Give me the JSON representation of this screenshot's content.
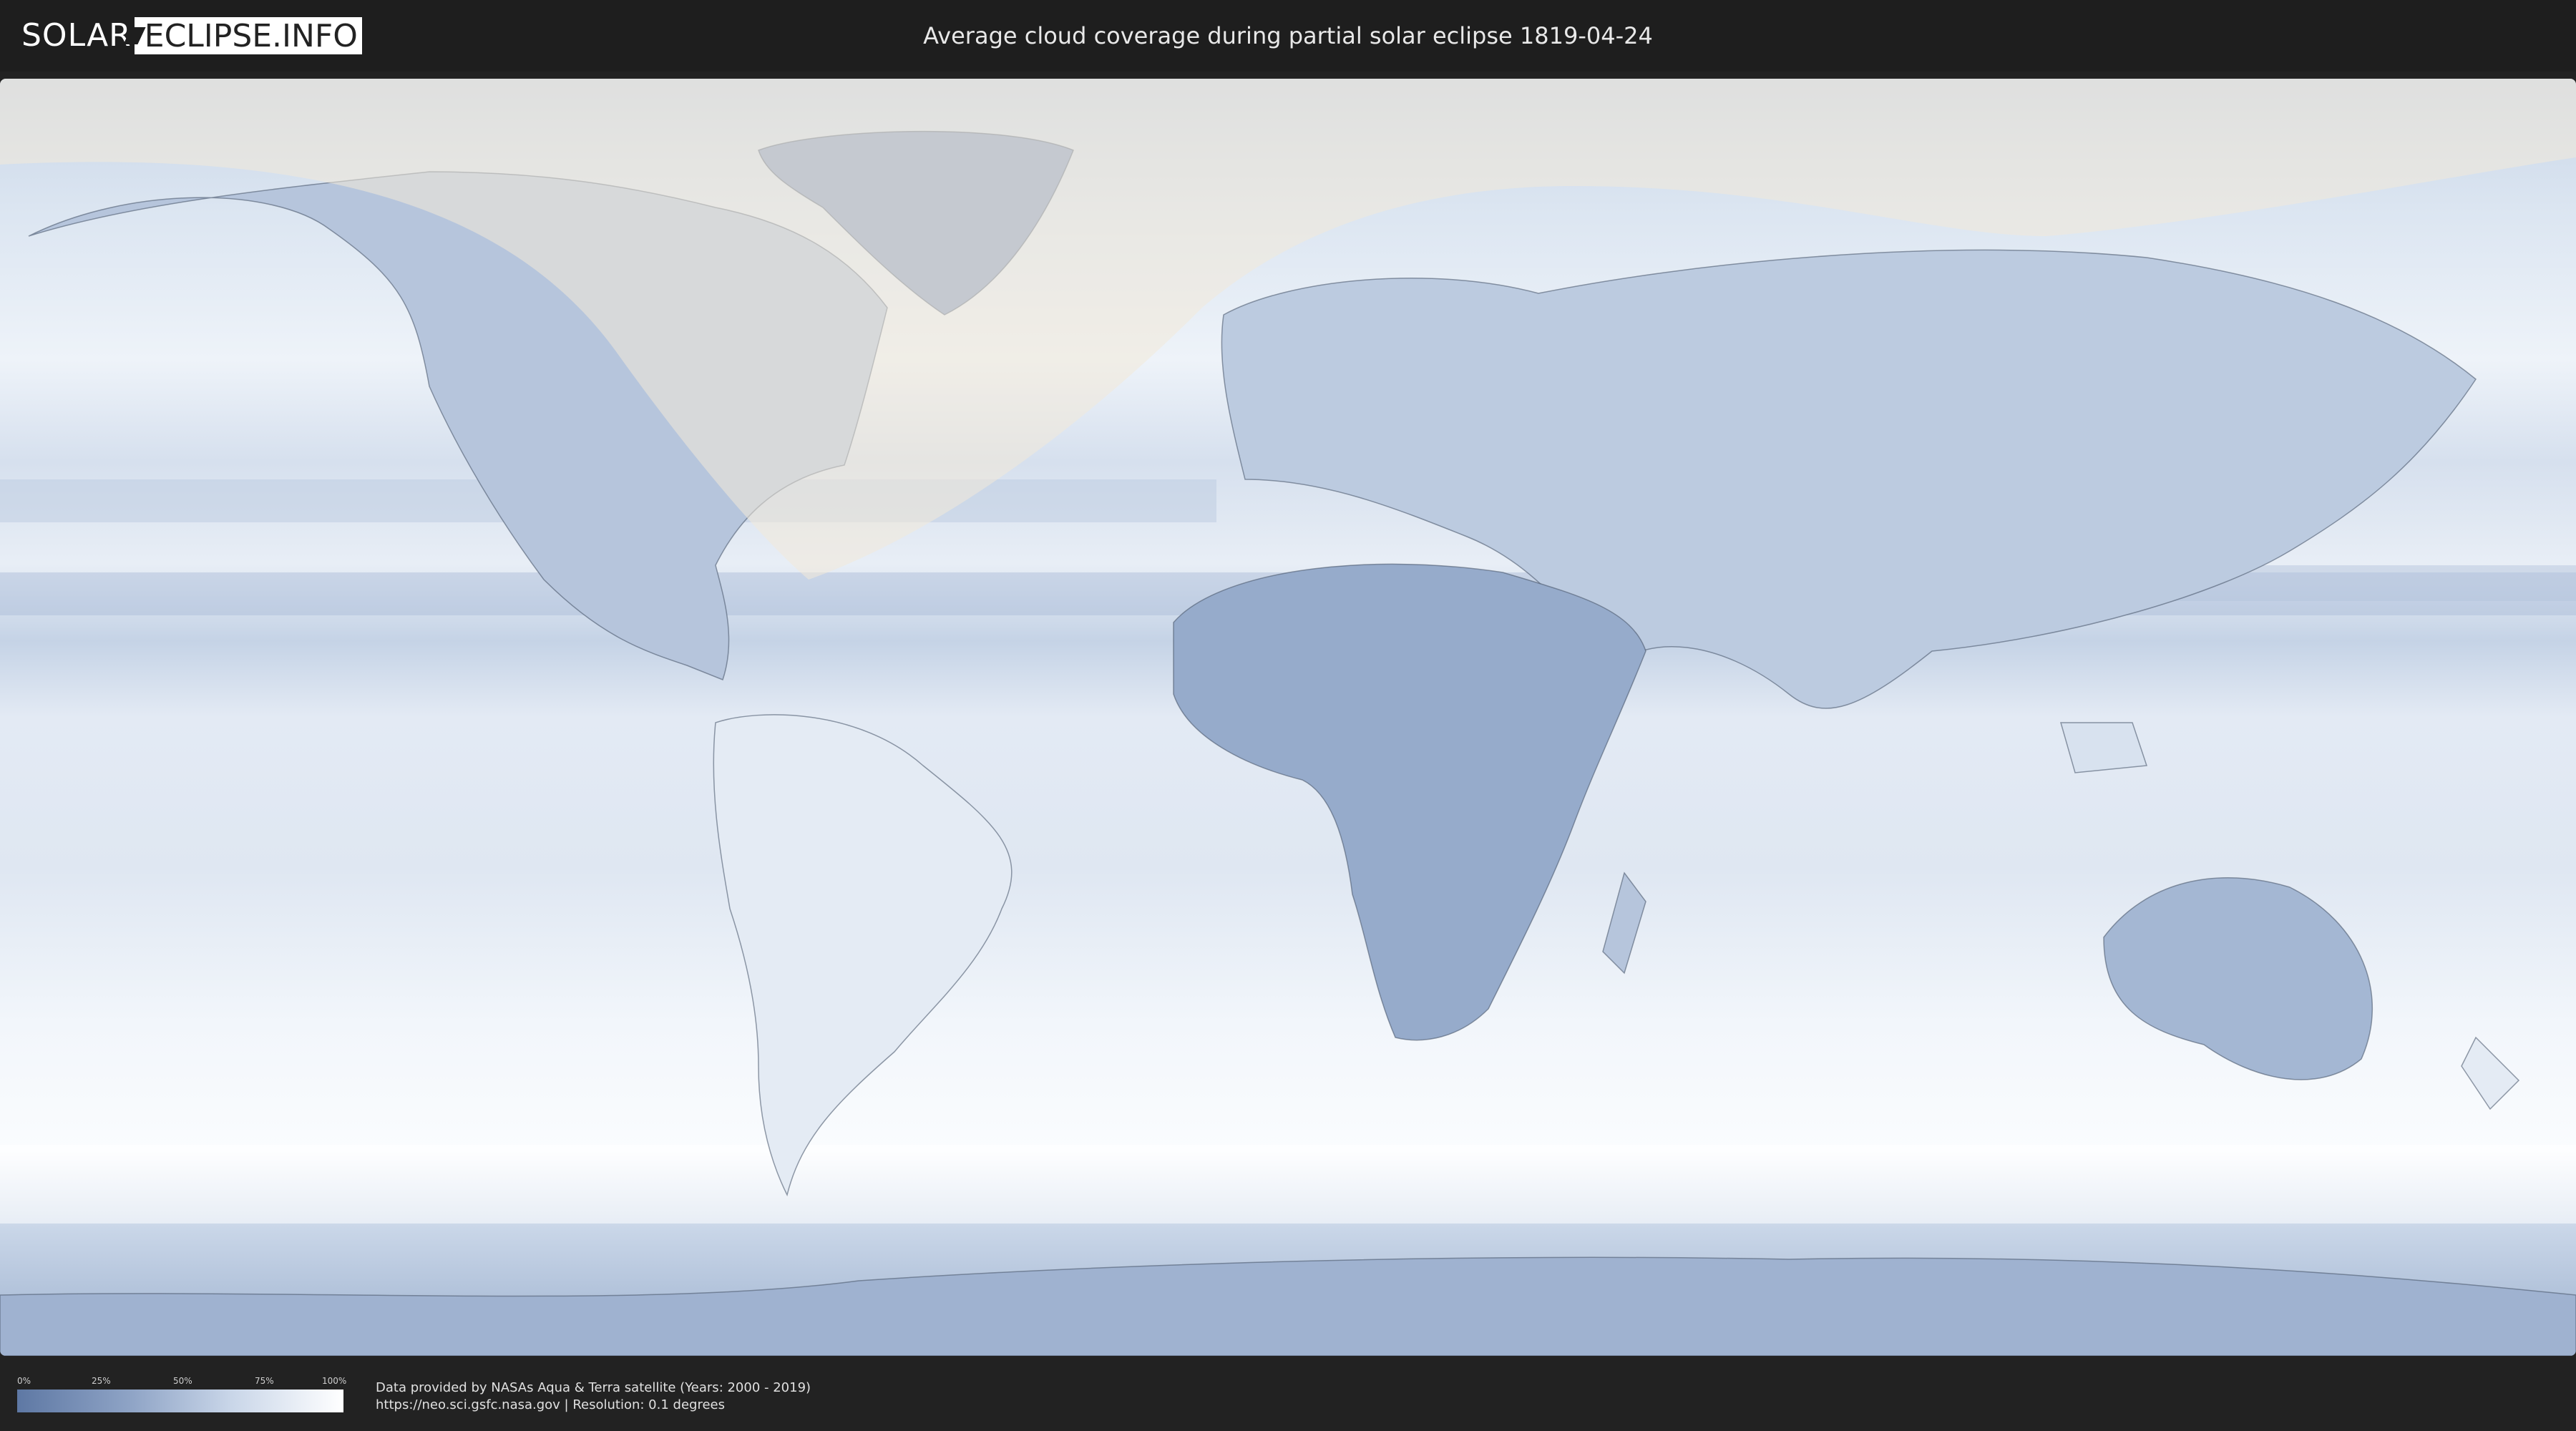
{
  "header": {
    "logo": {
      "part1": "SOLAR",
      "part2": "ECLIPSE.INFO"
    },
    "title": "Average cloud coverage during partial solar eclipse 1819-04-24"
  },
  "map": {
    "projection": "equirectangular",
    "colors": {
      "clear_sky": "#5e78a4",
      "full_cloud": "#ffffff",
      "eclipse_overlay": "#f3ead8",
      "borders": "#4d5a6e"
    }
  },
  "legend": {
    "ticks": [
      "0%",
      "25%",
      "50%",
      "75%",
      "100%"
    ],
    "gradient": [
      "#5e78a4",
      "#8fa4c6",
      "#c8d5e8",
      "#ffffff"
    ]
  },
  "credits": {
    "line1": "Data provided by NASAs Aqua & Terra satellite (Years: 2000 - 2019)",
    "line2": "https://neo.sci.gsfc.nasa.gov | Resolution: 0.1 degrees"
  }
}
